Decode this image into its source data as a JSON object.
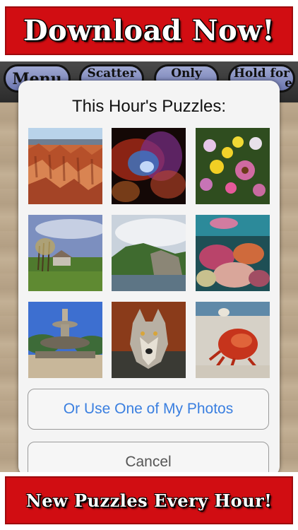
{
  "banners": {
    "top": "Download Now!",
    "bottom": "New Puzzles Every Hour!"
  },
  "toolbar": {
    "menu": "Menu",
    "scatter": "Scatter",
    "only": "Only",
    "hold_line1": "Hold for",
    "hold_line2": "e"
  },
  "dialog": {
    "title": "This Hour's Puzzles:",
    "photos": [
      {
        "name": "canyon"
      },
      {
        "name": "nebula"
      },
      {
        "name": "flowers"
      },
      {
        "name": "trees-house"
      },
      {
        "name": "island-cliff"
      },
      {
        "name": "coral-reef"
      },
      {
        "name": "fountain"
      },
      {
        "name": "wolf"
      },
      {
        "name": "hermit-crab"
      }
    ],
    "use_photos_button": "Or Use One of My Photos",
    "cancel_button": "Cancel"
  },
  "colors": {
    "banner_red": "#d10d12",
    "link_blue": "#3a7fe0"
  }
}
